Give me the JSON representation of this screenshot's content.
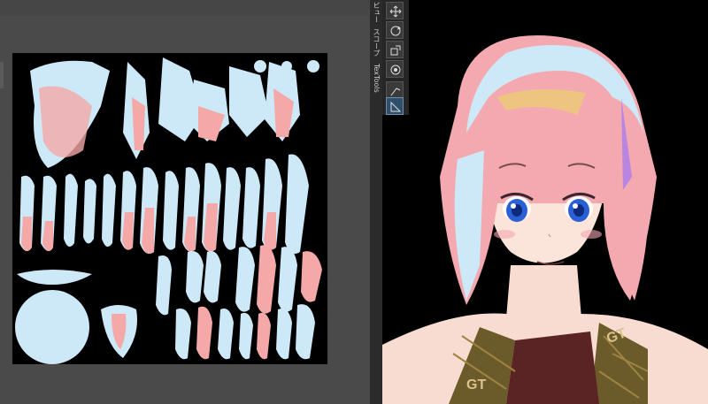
{
  "side_tabs": {
    "view": "ビュー",
    "scope": "スコープ",
    "textools": "TexTools"
  },
  "tools": [
    {
      "icon": "move-icon",
      "active": false
    },
    {
      "icon": "rotate-icon",
      "active": false
    },
    {
      "icon": "scale-icon",
      "active": false
    },
    {
      "icon": "transform-icon",
      "active": false
    },
    {
      "icon": "annotate-icon",
      "active": false
    },
    {
      "icon": "measure-icon",
      "active": true
    }
  ],
  "colors": {
    "editor_bg": "#4a4a4a",
    "canvas_bg": "#000000",
    "uv_blue": "#cde8f7",
    "uv_pink": "#f4a9a8",
    "accent": "#2f4f6a"
  },
  "jacket_text": "GT"
}
